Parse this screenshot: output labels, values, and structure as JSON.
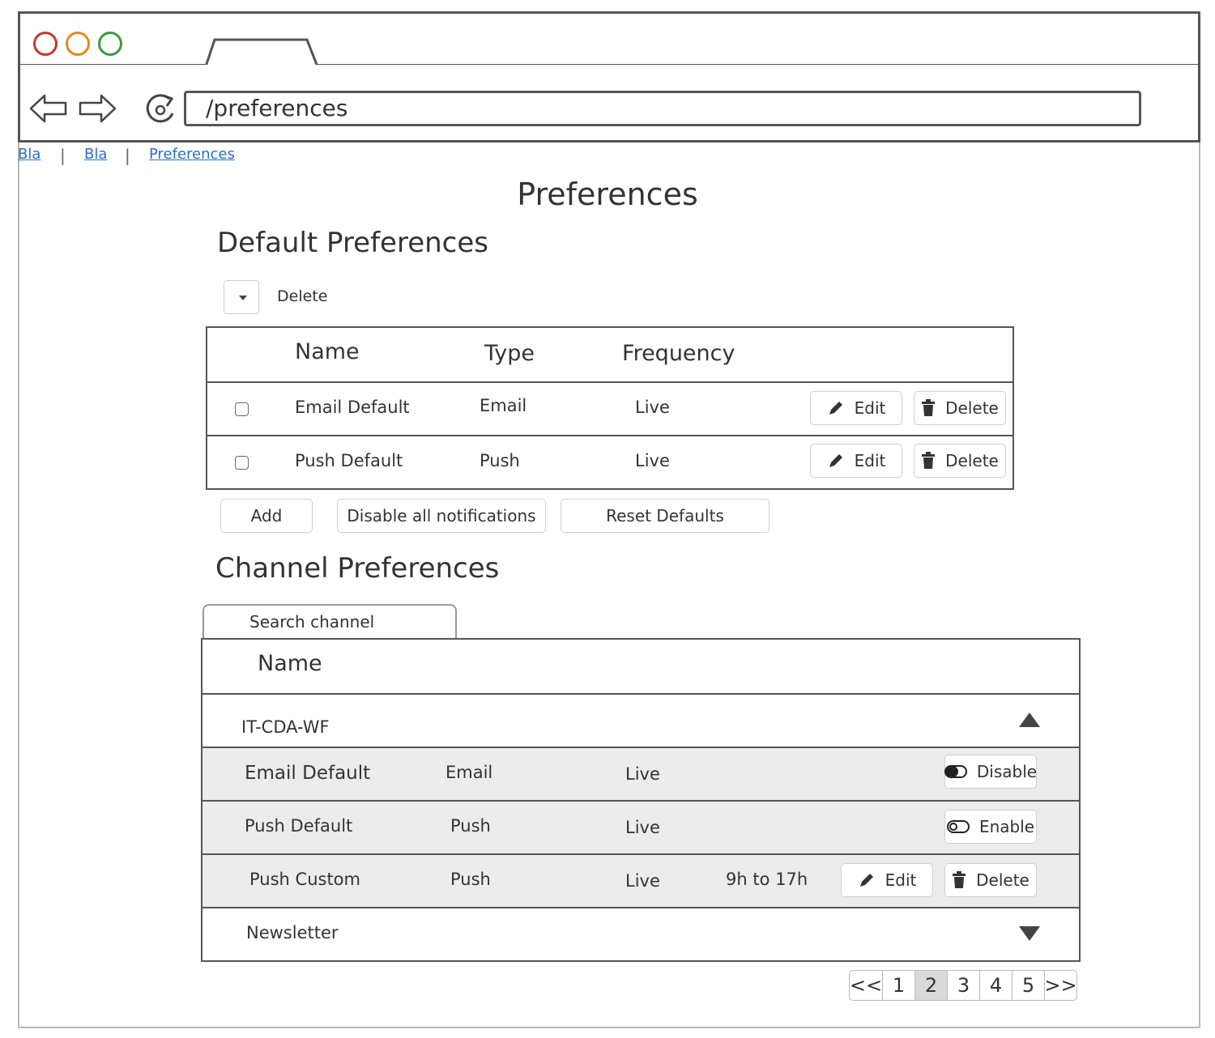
{
  "browser": {
    "url": "/preferences"
  },
  "breadcrumb": [
    "Bla",
    "Bla",
    "Preferences"
  ],
  "page_title": "Preferences",
  "default_prefs": {
    "heading": "Default Preferences",
    "bulk_action": "Delete",
    "columns": [
      "Name",
      "Type",
      "Frequency"
    ],
    "rows": [
      {
        "name": "Email Default",
        "type": "Email",
        "frequency": "Live",
        "edit": "Edit",
        "delete": "Delete"
      },
      {
        "name": "Push Default",
        "type": "Push",
        "frequency": "Live",
        "edit": "Edit",
        "delete": "Delete"
      }
    ],
    "buttons": {
      "add": "Add",
      "disable_all": "Disable all notifications",
      "reset": "Reset Defaults"
    }
  },
  "channel_prefs": {
    "heading": "Channel Preferences",
    "search_label": "Search channel",
    "column": "Name",
    "groups": [
      {
        "name": "IT-CDA-WF",
        "expanded": true,
        "rows": [
          {
            "name": "Email Default",
            "type": "Email",
            "frequency": "Live",
            "action": "Disable"
          },
          {
            "name": "Push Default",
            "type": "Push",
            "frequency": "Live",
            "action": "Enable"
          },
          {
            "name": "Push Custom",
            "type": "Push",
            "frequency": "Live",
            "schedule": "9h to 17h",
            "edit": "Edit",
            "delete": "Delete"
          }
        ]
      },
      {
        "name": "Newsletter",
        "expanded": false
      }
    ]
  },
  "pagination": {
    "prev": "<<",
    "pages": [
      "1",
      "2",
      "3",
      "4",
      "5"
    ],
    "current": "2",
    "next": ">>"
  },
  "colors": {
    "close": "#c0392b",
    "minimize": "#e08a1e",
    "maximize": "#3a9a3a",
    "link": "#2a6fc4",
    "row_shade": "#ececec"
  }
}
